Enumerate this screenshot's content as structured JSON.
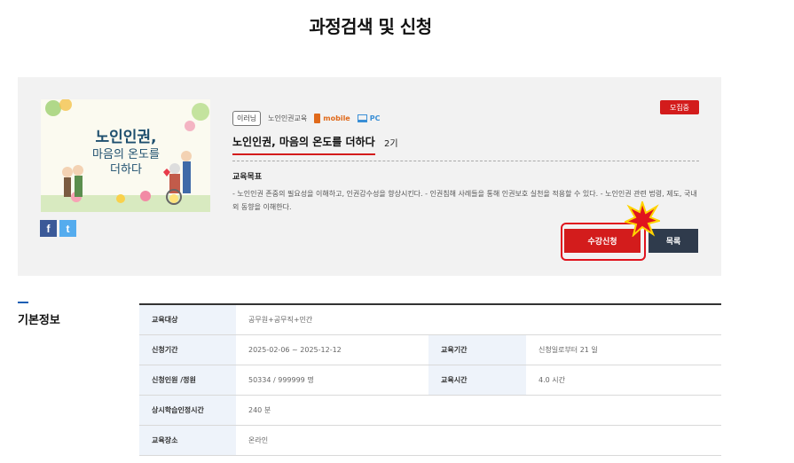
{
  "page": {
    "title": "과정검색 및 신청"
  },
  "course": {
    "level": "이러닝",
    "category": "노인인권교육",
    "device_mobile": "mobile",
    "device_pc": "PC",
    "status_badge": "모집중",
    "title": "노인인권, 마음의 온도를 더하다",
    "generation": "2기",
    "goal_label": "교육목표",
    "goal_text": "- 노인인권 존중의 필요성을 이해하고, 인권감수성을 향상시킨다. - 인권침해 사례들을 통해 인권보호 실천을 적용할 수 있다. - 노인인권 관련 법령, 제도, 국내외 동향을 이해한다.",
    "thumbnail": {
      "line1": "노인인권,",
      "line2": "마음의 온도를",
      "line3": "더하다"
    },
    "share": {
      "facebook": "f",
      "twitter": "t"
    }
  },
  "buttons": {
    "apply": "수강신청",
    "list": "목록"
  },
  "basic_info": {
    "title": "기본정보",
    "rows": [
      {
        "label": "교육대상",
        "value": "공무원+공무직+민간"
      },
      {
        "label": "신청기간",
        "value": "2025-02-06 ~ 2025-12-12",
        "label2": "교육기간",
        "value2": "신청일로부터 21 일"
      },
      {
        "label": "신청인원 /정원",
        "value": "50334 / 999999 명",
        "label2": "교육시간",
        "value2": "4.0 시간"
      },
      {
        "label": "상시학습인정시간",
        "value": "240 분"
      },
      {
        "label": "교육장소",
        "value": "온라인"
      }
    ]
  },
  "colors": {
    "accent_red": "#d31c1c",
    "dark_button": "#2f3b4c",
    "header_cell": "#eef3fa"
  }
}
